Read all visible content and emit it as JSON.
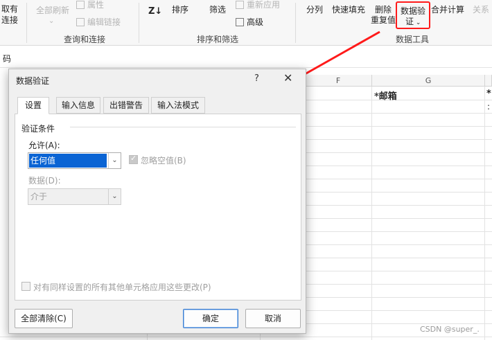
{
  "ribbon": {
    "partial_left_top": "取有",
    "partial_left_bottom": "连接",
    "refresh_all": "全部刷新",
    "properties": "属性",
    "edit_links": "编辑链接",
    "group_query": "查询和连接",
    "sort": "排序",
    "filter": "筛选",
    "reapply": "重新应用",
    "advanced": "高级",
    "group_sort_filter": "排序和筛选",
    "split": "分列",
    "flash_fill": "快速填充",
    "remove_dup_1": "删除",
    "remove_dup_2": "重复值",
    "data_validation_1": "数据验",
    "data_validation_2": "证",
    "consolidate": "合并计算",
    "relations": "关系",
    "group_data_tools": "数据工具"
  },
  "namebox": {
    "text": "码"
  },
  "sheet": {
    "col_f": "F",
    "col_g": "G",
    "header_email": "*邮箱",
    "header_next": "*",
    "cell_next": ":"
  },
  "dialog": {
    "title": "数据验证",
    "help": "?",
    "close": "✕",
    "tabs": [
      "设置",
      "输入信息",
      "出错警告",
      "输入法模式"
    ],
    "criteria_label": "验证条件",
    "allow_label": "允许(A):",
    "allow_value": "任何值",
    "ignore_blank": "忽略空值(B)",
    "data_label": "数据(D):",
    "data_value": "介于",
    "apply_all": "对有同样设置的所有其他单元格应用这些更改(P)",
    "clear_all": "全部清除(C)",
    "ok": "确定",
    "cancel": "取消"
  },
  "watermark": "CSDN @super_.",
  "colors": {
    "highlight": "#ff1a1a",
    "selection": "#0a64d4"
  }
}
